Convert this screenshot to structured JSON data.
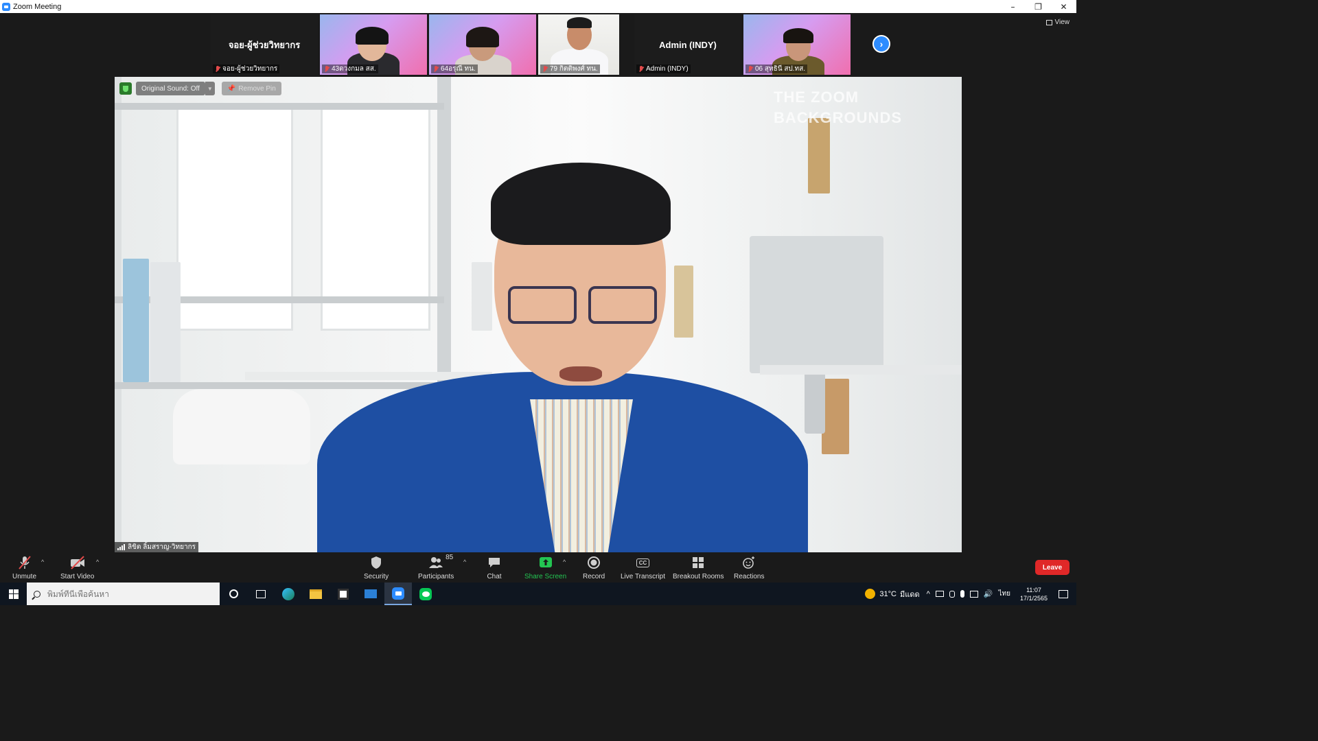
{
  "window": {
    "title": "Zoom Meeting",
    "controls": {
      "minimize": "–",
      "restore": "❐",
      "close": "✕"
    }
  },
  "thumbnails": [
    {
      "kind": "name-only",
      "display_name": "จอย-ผู้ช่วยวิทยากร",
      "label": "จอย-ผู้ช่วยวิทยากร",
      "muted": true
    },
    {
      "kind": "video",
      "label": "43ดวงกมล สส.",
      "muted": true
    },
    {
      "kind": "video",
      "label": "64อรุณี ทน.",
      "muted": true
    },
    {
      "kind": "video",
      "label": "79 กิตติพงศ์ ทน.",
      "muted": true
    },
    {
      "kind": "name-only",
      "display_name": "Admin (INDY)",
      "label": "Admin (INDY)",
      "muted": true
    },
    {
      "kind": "video",
      "label": "06 สุทธินี สป.ทส.",
      "muted": true
    }
  ],
  "view_button": {
    "label": "View",
    "icon": "grid-icon"
  },
  "main_video": {
    "original_sound": "Original Sound: Off",
    "remove_pin": "Remove Pin",
    "speaker_name": "ลิขิต ลิ้มสราญ-วิทยากร",
    "watermark": [
      "THE ZOOM",
      "BACKGROUNDS"
    ]
  },
  "toolbar": {
    "unmute": "Unmute",
    "start_video": "Start Video",
    "security": "Security",
    "participants": "Participants",
    "participants_count": "85",
    "chat": "Chat",
    "share_screen": "Share Screen",
    "record": "Record",
    "live_transcript": "Live Transcript",
    "cc": "CC",
    "breakout_rooms": "Breakout Rooms",
    "reactions": "Reactions",
    "leave": "Leave"
  },
  "colors": {
    "accent": "#2d8cff",
    "share_green": "#23c552",
    "leave_red": "#e02828",
    "muted_red": "#e24b4b"
  },
  "taskbar": {
    "search_placeholder": "พิมพ์ที่นี่เพื่อค้นหา",
    "weather": "31°C",
    "weather_desc": "มีแดด",
    "language": "ไทย",
    "time": "11:07",
    "date": "17/1/2565"
  }
}
